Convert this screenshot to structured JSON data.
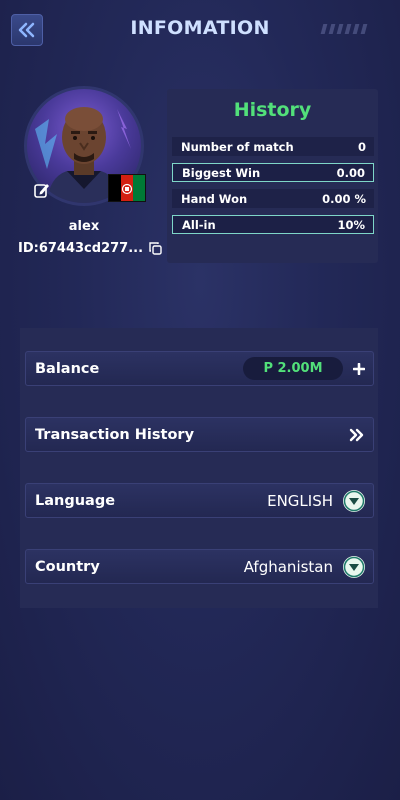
{
  "header": {
    "title": "INFOMATION",
    "back_icon": "double-chevron-left-icon"
  },
  "profile": {
    "username": "alex",
    "id_text": "ID:67443cd277...",
    "flag_colors": [
      "#000000",
      "#d32011",
      "#007a36"
    ]
  },
  "history": {
    "title": "History",
    "rows": [
      {
        "label": "Number of match",
        "value": "0"
      },
      {
        "label": "Biggest Win",
        "value": "0.00"
      },
      {
        "label": "Hand Won",
        "value": "0.00 %"
      },
      {
        "label": "All-in",
        "value": "10%"
      }
    ]
  },
  "settings": {
    "balance": {
      "label": "Balance",
      "value": "P 2.00M",
      "add_icon": "plus-icon"
    },
    "transactions": {
      "label": "Transaction History",
      "icon": "double-chevron-right-icon"
    },
    "language": {
      "label": "Language",
      "value": "ENGLISH"
    },
    "country": {
      "label": "Country",
      "value": "Afghanistan"
    }
  },
  "colors": {
    "accent_green": "#52e07a",
    "panel": "#262b55",
    "background": "#222857"
  }
}
